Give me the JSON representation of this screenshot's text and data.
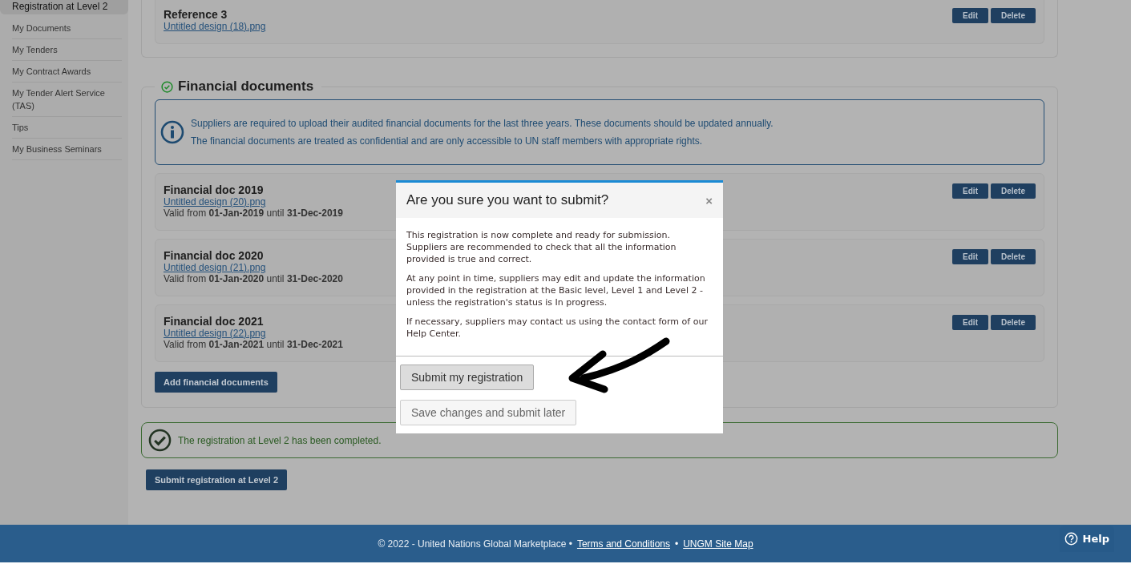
{
  "sidebar": {
    "items": [
      {
        "label": "Registration at Level 2",
        "selected": true
      },
      {
        "label": "My Documents",
        "selected": false
      },
      {
        "label": "My Tenders",
        "selected": false
      },
      {
        "label": "My Contract Awards",
        "selected": false
      },
      {
        "label": "My Tender Alert Service (TAS)",
        "selected": false
      },
      {
        "label": "Tips",
        "selected": false
      },
      {
        "label": "My Business Seminars",
        "selected": false
      }
    ]
  },
  "references": {
    "cards": [
      {
        "title": "Reference 3",
        "file": "Untitled design (18).png",
        "buttons": [
          "Edit",
          "Delete"
        ]
      }
    ]
  },
  "financial_section": {
    "title": "Financial documents",
    "info_lines": [
      "Suppliers are required to upload their audited financial documents for the last three years. These documents should be updated annually.",
      "The financial documents are treated as confidential and are only accessible to UN staff members with appropriate rights."
    ],
    "documents": [
      {
        "title": "Financial doc 2019",
        "file": "Untitled design (20).png",
        "validity": "Valid from **01-Jan-2019** until **31-Dec-2019**",
        "buttons": [
          "Edit",
          "Delete"
        ]
      },
      {
        "title": "Financial doc 2020",
        "file": "Untitled design (21).png",
        "validity": "Valid from **01-Jan-2020** until **31-Dec-2020**",
        "buttons": [
          "Edit",
          "Delete"
        ]
      },
      {
        "title": "Financial doc 2021",
        "file": "Untitled design (22).png",
        "validity": "Valid from **01-Jan-2021** until **31-Dec-2021**",
        "buttons": [
          "Edit",
          "Delete"
        ]
      }
    ],
    "add_button": "Add financial documents"
  },
  "status_message": "The registration at Level 2 has been completed.",
  "submit_button": "Submit registration at Level 2",
  "modal": {
    "title": "Are you sure you want to submit?",
    "close": "×",
    "paragraphs": [
      "This registration is now complete and ready for submission. Suppliers are recommended to check that all the information provided is true and correct.",
      "At any point in time, suppliers may edit and update the information provided in the registration at the Basic level, Level 1 and Level 2 - unless the registration's status is In progress.",
      "If necessary, suppliers may contact us using the contact form of our Help Center."
    ],
    "buttons": [
      {
        "label": "Submit my registration",
        "kind": "primary"
      },
      {
        "label": "Save changes and submit later",
        "kind": "secondary"
      }
    ]
  },
  "footer": {
    "copyright": "© 2022 - United Nations Global Marketplace •",
    "links": [
      {
        "label": "Terms and Conditions",
        "separator": "•"
      },
      {
        "label": "UNGM Site Map"
      }
    ],
    "help": "Help"
  }
}
